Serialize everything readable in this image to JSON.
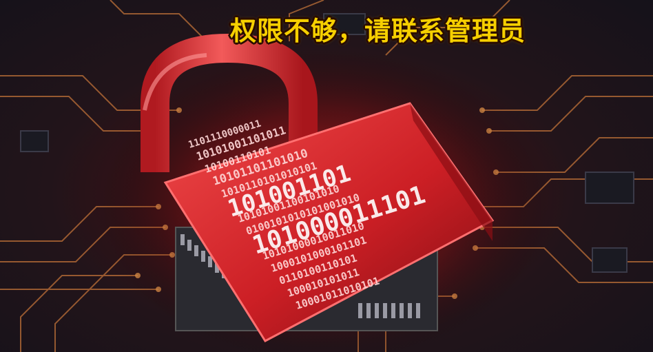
{
  "banner": {
    "text": "权限不够，请联系管理员",
    "color": "#f6d000"
  },
  "photo": {
    "subject": "lock-icon",
    "lock_color": "#d8262c",
    "circuit_color": "#c9773a",
    "binary_rows": [
      "1101110000011",
      "10101001101011",
      "10100110101",
      "10101101101010",
      "1010110101010101",
      "101001101",
      "10101001100101010",
      "0100101010101001010",
      "101000011101",
      "10101000010011010",
      "1000101000101101",
      "0110100110101",
      "100010101011",
      "10001011010101"
    ]
  }
}
